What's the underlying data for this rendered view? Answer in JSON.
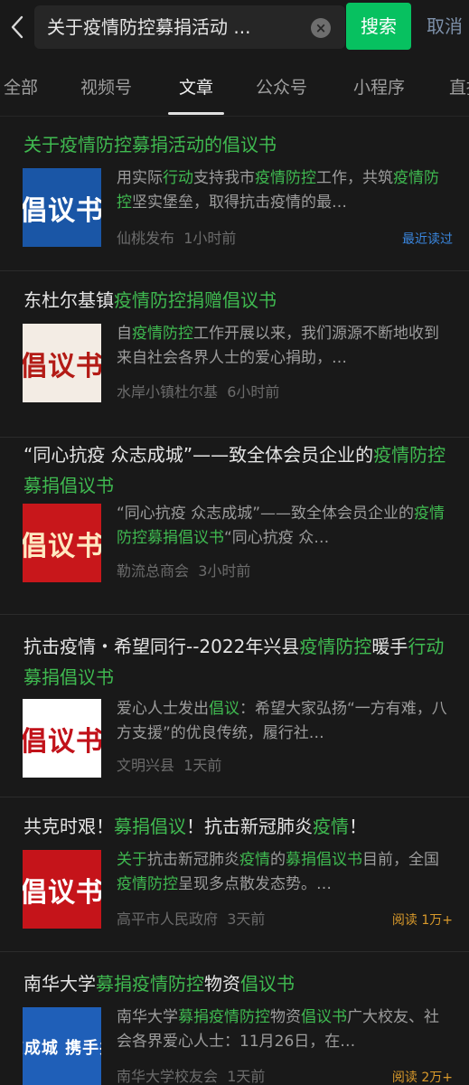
{
  "search": {
    "query": "关于疫情防控募捐活动 ...",
    "clear_symbol": "×",
    "button_label": "搜索",
    "cancel_label": "取消"
  },
  "tabs": [
    {
      "label": "全部",
      "active": false
    },
    {
      "label": "视频号",
      "active": false
    },
    {
      "label": "文章",
      "active": true
    },
    {
      "label": "公众号",
      "active": false
    },
    {
      "label": "小程序",
      "active": false
    },
    {
      "label": "直播",
      "active": false
    }
  ],
  "colors": {
    "highlight": "#3fb950",
    "accent_button": "#07c160",
    "recent_read": "#3a87e0",
    "read_count": "#d99a2b"
  },
  "results": [
    {
      "title": [
        {
          "t": "关于疫情防控募捐活动的倡议书",
          "h": true
        }
      ],
      "summary": [
        {
          "t": "用实际",
          "h": false
        },
        {
          "t": "行动",
          "h": true
        },
        {
          "t": "支持我市",
          "h": false
        },
        {
          "t": "疫情防控",
          "h": true
        },
        {
          "t": "工作，共筑",
          "h": false
        },
        {
          "t": "疫情防控",
          "h": true
        },
        {
          "t": "坚实堡垒，取得抗击疫情的最…",
          "h": false
        }
      ],
      "source": "仙桃发布",
      "time": "1小时前",
      "badge": "最近读过",
      "badge_kind": "recent",
      "thumb": {
        "text": "倡议书",
        "bg": "#1a56a6",
        "fg": "#ffffff",
        "mark": "",
        "mark_bg": "#ffffff",
        "mark_fg": "#1a56a6"
      }
    },
    {
      "title": [
        {
          "t": "东杜尔基镇",
          "h": false
        },
        {
          "t": "疫情防控捐赠倡议书",
          "h": true
        }
      ],
      "summary": [
        {
          "t": "自",
          "h": false
        },
        {
          "t": "疫情防控",
          "h": true
        },
        {
          "t": "工作开展以来，我们源源不断地收到来自社会各界人士的爱心捐助，…",
          "h": false
        }
      ],
      "source": "水岸小镇杜尔基",
      "time": "6小时前",
      "badge": "",
      "badge_kind": "",
      "thumb": {
        "text": "倡议书",
        "bg": "#f3ece4",
        "fg": "#b31b16",
        "mark": "",
        "mark_bg": "#b31b16",
        "mark_fg": "#ffffff"
      }
    },
    {
      "title": [
        {
          "t": "“同心抗疫 众志成城”——致全体会员企业的",
          "h": false
        },
        {
          "t": "疫情防控募捐倡议书",
          "h": true
        }
      ],
      "summary": [
        {
          "t": "“同心抗疫 众志成城”——致全体会员企业的",
          "h": false
        },
        {
          "t": "疫情防控募捐倡议书",
          "h": true
        },
        {
          "t": "“同心抗疫 众…",
          "h": false
        }
      ],
      "source": "勒流总商会",
      "time": "3小时前",
      "badge": "",
      "badge_kind": "",
      "thumb": {
        "text": "倡议书",
        "bg": "#c8171b",
        "fg": "#ffe9c2",
        "mark": "",
        "mark_bg": "#ffffff",
        "mark_fg": "#c8171b"
      }
    },
    {
      "title": [
        {
          "t": "抗击疫情・希望同行--2022年兴县",
          "h": false
        },
        {
          "t": "疫情防控",
          "h": true
        },
        {
          "t": "暖手",
          "h": false
        },
        {
          "t": "行动募捐倡议书",
          "h": true
        }
      ],
      "summary": [
        {
          "t": "爱心人士发出",
          "h": false
        },
        {
          "t": "倡议",
          "h": true
        },
        {
          "t": "：希望大家弘扬“一方有难，八方支援”的优良传统，履行社…",
          "h": false
        }
      ],
      "source": "文明兴县",
      "time": "1天前",
      "badge": "",
      "badge_kind": "",
      "thumb": {
        "text": "倡议书",
        "bg": "#ffffff",
        "fg": "#c1121a",
        "mark": "",
        "mark_bg": "#c1121a",
        "mark_fg": "#ffffff"
      }
    },
    {
      "title": [
        {
          "t": "共克时艰！",
          "h": false
        },
        {
          "t": "募捐倡议",
          "h": true
        },
        {
          "t": "！抗击新冠肺炎",
          "h": false
        },
        {
          "t": "疫情",
          "h": true
        },
        {
          "t": "！",
          "h": false
        }
      ],
      "summary": [
        {
          "t": "关于",
          "h": true
        },
        {
          "t": "抗击新冠肺炎",
          "h": false
        },
        {
          "t": "疫情",
          "h": true
        },
        {
          "t": "的",
          "h": false
        },
        {
          "t": "募捐倡议书",
          "h": true
        },
        {
          "t": "目前，全国",
          "h": false
        },
        {
          "t": "疫情防控",
          "h": true
        },
        {
          "t": "呈现多点散发态势。…",
          "h": false
        }
      ],
      "source": "高平市人民政府",
      "time": "3天前",
      "badge": "阅读 1万+",
      "badge_kind": "reads",
      "thumb": {
        "text": "倡议书",
        "bg": "#c5141a",
        "fg": "#ffffff",
        "mark": "",
        "mark_bg": "#ffffff",
        "mark_fg": "#c5141a"
      }
    },
    {
      "title": [
        {
          "t": "南华大学",
          "h": false
        },
        {
          "t": "募捐疫情防控",
          "h": true
        },
        {
          "t": "物资",
          "h": false
        },
        {
          "t": "倡议书",
          "h": true
        }
      ],
      "summary": [
        {
          "t": "南华大学",
          "h": false
        },
        {
          "t": "募捐疫情防控",
          "h": true
        },
        {
          "t": "物资",
          "h": false
        },
        {
          "t": "倡议书",
          "h": true
        },
        {
          "t": "广大校友、社会各界爱心人士：11月26日，在…",
          "h": false
        }
      ],
      "source": "南华大学校友会",
      "time": "1天前",
      "badge": "阅读 2万+",
      "badge_kind": "reads",
      "thumb": {
        "text": "众志成城 携手共克",
        "bg": "#1f5fb8",
        "fg": "#ffffff",
        "mark": "",
        "mark_bg": "#ffffff",
        "mark_fg": "#1f5fb8"
      }
    }
  ]
}
